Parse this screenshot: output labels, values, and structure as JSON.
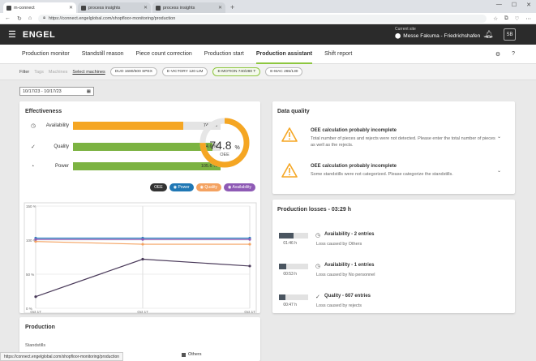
{
  "browser": {
    "tabs": [
      {
        "label": "m-connect",
        "active": true
      },
      {
        "label": "process insights",
        "active": false
      },
      {
        "label": "process insights",
        "active": false
      }
    ],
    "url": "https://connect.engelglobal.com/shopfloor-monitoring/production",
    "status_url": "https://connect.engelglobal.com/shopfloor-monitoring/production"
  },
  "header": {
    "logo": "ENGEL",
    "site_label": "Current site",
    "site_value": "Messe Fakuma - Friedrichshafen",
    "avatar": "SB"
  },
  "nav": {
    "tabs": [
      "Production monitor",
      "Standstill reason",
      "Piece count correction",
      "Production start",
      "Production assistant",
      "Shift report"
    ],
    "active_index": 4
  },
  "filters": {
    "label": "Filter",
    "tags": "Tags",
    "machines": "Machines",
    "select": "Select machines",
    "chips": [
      "DUO 1680/500 SPEX",
      "E-VICTORY 120 LIM",
      "E-MOTION 740/280 T",
      "E-MAC 265/130"
    ],
    "selected_index": 2
  },
  "date_range": "10/17/23 - 10/17/23",
  "effectiveness": {
    "title": "Effectiveness",
    "kpis": [
      {
        "name": "Availability",
        "value": 74.9,
        "label": "74.9 %",
        "color": "#f5a623",
        "icon": "availability-icon"
      },
      {
        "name": "Quality",
        "value": 94.6,
        "label": "94.6 %",
        "color": "#7cb342",
        "icon": "quality-check-icon"
      },
      {
        "name": "Power",
        "value": 100,
        "label": "105.6 %",
        "color": "#7cb342",
        "icon": "power-gauge-icon"
      }
    ],
    "oee": {
      "value": 74.8,
      "label": "74.8",
      "unit": "%",
      "caption": "OEE",
      "color": "#f5a623"
    },
    "legend": [
      {
        "label": "OEE",
        "color": "#333333"
      },
      {
        "label": "Power",
        "color": "#1f77b4"
      },
      {
        "label": "Quality",
        "color": "#f4a261"
      },
      {
        "label": "Availability",
        "color": "#8e5ab5"
      }
    ]
  },
  "chart_data": {
    "type": "line",
    "x": [
      "Oct 17",
      "Oct 17",
      "Oct 17"
    ],
    "yticks": [
      "150 %",
      "100 %",
      "50 %",
      "0 %"
    ],
    "ylim": [
      0,
      150
    ],
    "series": [
      {
        "name": "OEE",
        "color": "#4a3a5a",
        "values": [
          17,
          72,
          62
        ]
      },
      {
        "name": "Power",
        "color": "#2e86c1",
        "values": [
          103,
          103,
          103
        ]
      },
      {
        "name": "Quality",
        "color": "#f4a261",
        "values": [
          98,
          94,
          94
        ]
      },
      {
        "name": "Availability",
        "color": "#8e5ab5",
        "values": [
          101,
          101,
          101
        ]
      }
    ]
  },
  "data_quality": {
    "title": "Data quality",
    "items": [
      {
        "title": "OEE calculation probably incomplete",
        "message": "Total number of pieces and rejects were not detected. Please enter the total number of pieces as well as the rejects."
      },
      {
        "title": "OEE calculation probably incomplete",
        "message": "Some standstills were not categorized. Please categorize the standstills."
      }
    ]
  },
  "losses": {
    "title": "Production losses - 03:29 h",
    "items": [
      {
        "time": "01:46 h",
        "fill": 0.5,
        "title": "Availability - 2 entries",
        "sub": "Loss caused by Others",
        "icon": "availability-icon"
      },
      {
        "time": "00:53 h",
        "fill": 0.25,
        "title": "Availability - 1 entries",
        "sub": "Loss caused by No personnel",
        "icon": "availability-icon"
      },
      {
        "time": "00:47 h",
        "fill": 0.22,
        "title": "Quality - 607 entries",
        "sub": "Loss caused by rejects",
        "icon": "quality-check-icon"
      }
    ]
  },
  "production": {
    "title": "Production",
    "sub": "Standstills",
    "legend_others": "Others"
  }
}
